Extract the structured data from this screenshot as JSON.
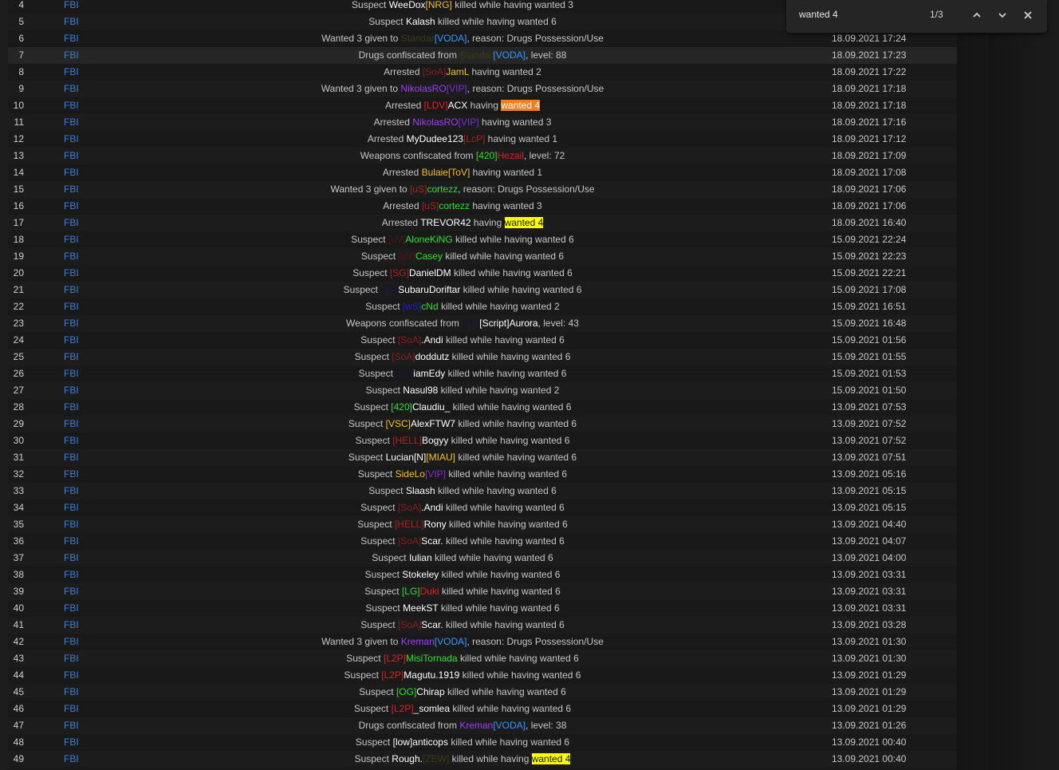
{
  "find_bar": {
    "query": "wanted 4",
    "match_count": "1/3"
  },
  "rows": [
    {
      "num": "4",
      "faction": "FBI",
      "date": "",
      "segments": [
        {
          "t": "Suspect ",
          "c": "#c6c6c6"
        },
        {
          "t": "WeeDox",
          "c": "#ffffff"
        },
        {
          "t": "[NRG]",
          "c": "#f2c21b"
        },
        {
          "t": " killed while having wanted 3",
          "c": "#c6c6c6"
        }
      ]
    },
    {
      "num": "5",
      "faction": "FBI",
      "date": "",
      "segments": [
        {
          "t": "Suspect ",
          "c": "#c6c6c6"
        },
        {
          "t": "Kalash",
          "c": "#ffffff"
        },
        {
          "t": " killed while having wanted 6",
          "c": "#c6c6c6"
        }
      ]
    },
    {
      "num": "6",
      "faction": "FBI",
      "date": "18.09.2021 17:24",
      "segments": [
        {
          "t": "Wanted 3 given to ",
          "c": "#c6c6c6"
        },
        {
          "t": "Standar",
          "c": "#3c3c14"
        },
        {
          "t": "[VODA]",
          "c": "#2d9bff"
        },
        {
          "t": ", reason: Drugs Possession/Use",
          "c": "#c6c6c6"
        }
      ]
    },
    {
      "num": "7",
      "faction": "FBI",
      "date": "18.09.2021 17:23",
      "segments": [
        {
          "t": "Drugs confiscated from ",
          "c": "#c6c6c6"
        },
        {
          "t": "Standar",
          "c": "#3c3c14"
        },
        {
          "t": "[VODA]",
          "c": "#2d9bff"
        },
        {
          "t": ", level: 88",
          "c": "#c6c6c6"
        }
      ]
    },
    {
      "num": "8",
      "faction": "FBI",
      "date": "18.09.2021 17:22",
      "segments": [
        {
          "t": "Arrested ",
          "c": "#c6c6c6"
        },
        {
          "t": "[SoA]",
          "c": "#8c1f1f"
        },
        {
          "t": "JamL",
          "c": "#f2c21b"
        },
        {
          "t": " having wanted 2",
          "c": "#c6c6c6"
        }
      ]
    },
    {
      "num": "9",
      "faction": "FBI",
      "date": "18.09.2021 17:18",
      "segments": [
        {
          "t": "Wanted 3 given to ",
          "c": "#c6c6c6"
        },
        {
          "t": "NikolasRO",
          "c": "#a23cff"
        },
        {
          "t": "[VIP]",
          "c": "#7b2fd0"
        },
        {
          "t": ", reason: Drugs Possession/Use",
          "c": "#c6c6c6"
        }
      ]
    },
    {
      "num": "10",
      "faction": "FBI",
      "date": "18.09.2021 17:18",
      "segments": [
        {
          "t": "Arrested ",
          "c": "#c6c6c6"
        },
        {
          "t": "[LDV]",
          "c": "#e02020"
        },
        {
          "t": "ACX",
          "c": "#ffffff"
        },
        {
          "t": " having ",
          "c": "#c6c6c6"
        },
        {
          "t": "wanted 4",
          "c": "#ffffff",
          "bg": "#f07f1e"
        }
      ]
    },
    {
      "num": "11",
      "faction": "FBI",
      "date": "18.09.2021 17:16",
      "segments": [
        {
          "t": "Arrested ",
          "c": "#c6c6c6"
        },
        {
          "t": "NikolasRO",
          "c": "#a23cff"
        },
        {
          "t": "[VIP]",
          "c": "#7b2fd0"
        },
        {
          "t": " having wanted 3",
          "c": "#c6c6c6"
        }
      ]
    },
    {
      "num": "12",
      "faction": "FBI",
      "date": "18.09.2021 17:12",
      "segments": [
        {
          "t": "Arrested ",
          "c": "#c6c6c6"
        },
        {
          "t": "MyDudee123",
          "c": "#ffffff"
        },
        {
          "t": "[LcP]",
          "c": "#b02020"
        },
        {
          "t": " having wanted 1",
          "c": "#c6c6c6"
        }
      ]
    },
    {
      "num": "13",
      "faction": "FBI",
      "date": "18.09.2021 17:09",
      "segments": [
        {
          "t": "Weapons confiscated from ",
          "c": "#c6c6c6"
        },
        {
          "t": "[420]",
          "c": "#2ee02e"
        },
        {
          "t": "Hezail",
          "c": "#e02020"
        },
        {
          "t": ", level: 72",
          "c": "#c6c6c6"
        }
      ]
    },
    {
      "num": "14",
      "faction": "FBI",
      "date": "18.09.2021 17:08",
      "segments": [
        {
          "t": "Arrested ",
          "c": "#c6c6c6"
        },
        {
          "t": "Bulaie",
          "c": "#f2c21b"
        },
        {
          "t": "[ToV]",
          "c": "#f2c21b"
        },
        {
          "t": " having wanted 1",
          "c": "#c6c6c6"
        }
      ]
    },
    {
      "num": "15",
      "faction": "FBI",
      "date": "18.09.2021 17:06",
      "segments": [
        {
          "t": "Wanted 3 given to ",
          "c": "#c6c6c6"
        },
        {
          "t": "[uS]",
          "c": "#b02020"
        },
        {
          "t": "cortezz",
          "c": "#2ee02e"
        },
        {
          "t": ", reason: Drugs Possession/Use",
          "c": "#c6c6c6"
        }
      ]
    },
    {
      "num": "16",
      "faction": "FBI",
      "date": "18.09.2021 17:06",
      "segments": [
        {
          "t": "Arrested ",
          "c": "#c6c6c6"
        },
        {
          "t": "[uS]",
          "c": "#b02020"
        },
        {
          "t": "cortezz",
          "c": "#2ee02e"
        },
        {
          "t": " having wanted 3",
          "c": "#c6c6c6"
        }
      ]
    },
    {
      "num": "17",
      "faction": "FBI",
      "date": "18.09.2021 16:40",
      "segments": [
        {
          "t": "Arrested ",
          "c": "#c6c6c6"
        },
        {
          "t": "TREVOR42",
          "c": "#ffffff"
        },
        {
          "t": " having ",
          "c": "#c6c6c6"
        },
        {
          "t": "wanted 4",
          "c": "#111111",
          "bg": "#ffff00"
        }
      ]
    },
    {
      "num": "18",
      "faction": "FBI",
      "date": "15.09.2021 22:24",
      "segments": [
        {
          "t": "Suspect ",
          "c": "#c6c6c6"
        },
        {
          "t": "[uV]",
          "c": "#5a1414"
        },
        {
          "t": "AloneKiNG",
          "c": "#2ee02e"
        },
        {
          "t": " killed while having wanted 6",
          "c": "#c6c6c6"
        }
      ]
    },
    {
      "num": "19",
      "faction": "FBI",
      "date": "15.09.2021 22:23",
      "segments": [
        {
          "t": "Suspect ",
          "c": "#c6c6c6"
        },
        {
          "t": "[uV]",
          "c": "#5a1414"
        },
        {
          "t": "Casey",
          "c": "#2ee02e"
        },
        {
          "t": " killed while having wanted 6",
          "c": "#c6c6c6"
        }
      ]
    },
    {
      "num": "20",
      "faction": "FBI",
      "date": "15.09.2021 22:21",
      "segments": [
        {
          "t": "Suspect ",
          "c": "#c6c6c6"
        },
        {
          "t": "[SG]",
          "c": "#b02020"
        },
        {
          "t": "DanielDM",
          "c": "#ffffff"
        },
        {
          "t": " killed while having wanted 6",
          "c": "#c6c6c6"
        }
      ]
    },
    {
      "num": "21",
      "faction": "FBI",
      "date": "15.09.2021 17:08",
      "segments": [
        {
          "t": "Suspect ",
          "c": "#c6c6c6"
        },
        {
          "t": "[FB]",
          "c": "#15153c"
        },
        {
          "t": "SubaruDoriftar",
          "c": "#ffffff"
        },
        {
          "t": " killed while having wanted 6",
          "c": "#c6c6c6"
        }
      ]
    },
    {
      "num": "22",
      "faction": "FBI",
      "date": "15.09.2021 16:51",
      "segments": [
        {
          "t": "Suspect ",
          "c": "#c6c6c6"
        },
        {
          "t": "[wS]",
          "c": "#2020e0"
        },
        {
          "t": "cNd",
          "c": "#2ee02e"
        },
        {
          "t": " killed while having wanted 2",
          "c": "#c6c6c6"
        }
      ]
    },
    {
      "num": "23",
      "faction": "FBI",
      "date": "15.09.2021 16:48",
      "segments": [
        {
          "t": "Weapons confiscated from ",
          "c": "#c6c6c6"
        },
        {
          "t": "[FB]",
          "c": "#15153c"
        },
        {
          "t": "[Script]Aurora",
          "c": "#ffffff"
        },
        {
          "t": ", level: 43",
          "c": "#c6c6c6"
        }
      ]
    },
    {
      "num": "24",
      "faction": "FBI",
      "date": "15.09.2021 01:56",
      "segments": [
        {
          "t": "Suspect ",
          "c": "#c6c6c6"
        },
        {
          "t": "[SoA]",
          "c": "#8c1f1f"
        },
        {
          "t": ".Andi",
          "c": "#ffffff"
        },
        {
          "t": " killed while having wanted 6",
          "c": "#c6c6c6"
        }
      ]
    },
    {
      "num": "25",
      "faction": "FBI",
      "date": "15.09.2021 01:55",
      "segments": [
        {
          "t": "Suspect ",
          "c": "#c6c6c6"
        },
        {
          "t": "[SoA]",
          "c": "#8c1f1f"
        },
        {
          "t": "doddutz",
          "c": "#ffffff"
        },
        {
          "t": " killed while having wanted 6",
          "c": "#c6c6c6"
        }
      ]
    },
    {
      "num": "26",
      "faction": "FBI",
      "date": "15.09.2021 01:53",
      "segments": [
        {
          "t": "Suspect ",
          "c": "#c6c6c6"
        },
        {
          "t": "[FB]",
          "c": "#15153c"
        },
        {
          "t": "iamEdy",
          "c": "#ffffff"
        },
        {
          "t": " killed while having wanted 6",
          "c": "#c6c6c6"
        }
      ]
    },
    {
      "num": "27",
      "faction": "FBI",
      "date": "15.09.2021 01:50",
      "segments": [
        {
          "t": "Suspect ",
          "c": "#c6c6c6"
        },
        {
          "t": "Nasul98",
          "c": "#ffffff"
        },
        {
          "t": " killed while having wanted 2",
          "c": "#c6c6c6"
        }
      ]
    },
    {
      "num": "28",
      "faction": "FBI",
      "date": "13.09.2021 07:53",
      "segments": [
        {
          "t": "Suspect ",
          "c": "#c6c6c6"
        },
        {
          "t": "[420]",
          "c": "#2ee02e"
        },
        {
          "t": "Claudiu_",
          "c": "#ffffff"
        },
        {
          "t": " killed while having wanted 6",
          "c": "#c6c6c6"
        }
      ]
    },
    {
      "num": "29",
      "faction": "FBI",
      "date": "13.09.2021 07:52",
      "segments": [
        {
          "t": "Suspect ",
          "c": "#c6c6c6"
        },
        {
          "t": "[VSC]",
          "c": "#f2c21b"
        },
        {
          "t": "AlexFTW7",
          "c": "#ffffff"
        },
        {
          "t": " killed while having wanted 6",
          "c": "#c6c6c6"
        }
      ]
    },
    {
      "num": "30",
      "faction": "FBI",
      "date": "13.09.2021 07:52",
      "segments": [
        {
          "t": "Suspect ",
          "c": "#c6c6c6"
        },
        {
          "t": "[HELL]",
          "c": "#b02020"
        },
        {
          "t": "Bogyy",
          "c": "#ffffff"
        },
        {
          "t": " killed while having wanted 6",
          "c": "#c6c6c6"
        }
      ]
    },
    {
      "num": "31",
      "faction": "FBI",
      "date": "13.09.2021 07:51",
      "segments": [
        {
          "t": "Suspect ",
          "c": "#c6c6c6"
        },
        {
          "t": "Lucian[N]",
          "c": "#ffffff"
        },
        {
          "t": "[MIAU]",
          "c": "#f2c21b"
        },
        {
          "t": " killed while having wanted 6",
          "c": "#c6c6c6"
        }
      ]
    },
    {
      "num": "32",
      "faction": "FBI",
      "date": "13.09.2021 05:16",
      "segments": [
        {
          "t": "Suspect ",
          "c": "#c6c6c6"
        },
        {
          "t": "SideLo",
          "c": "#f2c21b"
        },
        {
          "t": "[VIP]",
          "c": "#7b2fd0"
        },
        {
          "t": " killed while having wanted 6",
          "c": "#c6c6c6"
        }
      ]
    },
    {
      "num": "33",
      "faction": "FBI",
      "date": "13.09.2021 05:15",
      "segments": [
        {
          "t": "Suspect ",
          "c": "#c6c6c6"
        },
        {
          "t": "Slaash",
          "c": "#ffffff"
        },
        {
          "t": " killed while having wanted 6",
          "c": "#c6c6c6"
        }
      ]
    },
    {
      "num": "34",
      "faction": "FBI",
      "date": "13.09.2021 05:15",
      "segments": [
        {
          "t": "Suspect ",
          "c": "#c6c6c6"
        },
        {
          "t": "[SoA]",
          "c": "#8c1f1f"
        },
        {
          "t": ".Andi",
          "c": "#ffffff"
        },
        {
          "t": " killed while having wanted 6",
          "c": "#c6c6c6"
        }
      ]
    },
    {
      "num": "35",
      "faction": "FBI",
      "date": "13.09.2021 04:40",
      "segments": [
        {
          "t": "Suspect ",
          "c": "#c6c6c6"
        },
        {
          "t": "[HELL]",
          "c": "#b02020"
        },
        {
          "t": "Rony",
          "c": "#ffffff"
        },
        {
          "t": " killed while having wanted 6",
          "c": "#c6c6c6"
        }
      ]
    },
    {
      "num": "36",
      "faction": "FBI",
      "date": "13.09.2021 04:07",
      "segments": [
        {
          "t": "Suspect ",
          "c": "#c6c6c6"
        },
        {
          "t": "[SoA]",
          "c": "#8c1f1f"
        },
        {
          "t": "Scar.",
          "c": "#ffffff"
        },
        {
          "t": " killed while having wanted 6",
          "c": "#c6c6c6"
        }
      ]
    },
    {
      "num": "37",
      "faction": "FBI",
      "date": "13.09.2021 04:00",
      "segments": [
        {
          "t": "Suspect ",
          "c": "#c6c6c6"
        },
        {
          "t": "Iulian",
          "c": "#ffffff"
        },
        {
          "t": " killed while having wanted 6",
          "c": "#c6c6c6"
        }
      ]
    },
    {
      "num": "38",
      "faction": "FBI",
      "date": "13.09.2021 03:31",
      "segments": [
        {
          "t": "Suspect ",
          "c": "#c6c6c6"
        },
        {
          "t": "Stokeley",
          "c": "#ffffff"
        },
        {
          "t": " killed while having wanted 6",
          "c": "#c6c6c6"
        }
      ]
    },
    {
      "num": "39",
      "faction": "FBI",
      "date": "13.09.2021 03:31",
      "segments": [
        {
          "t": "Suspect ",
          "c": "#c6c6c6"
        },
        {
          "t": "[LG]",
          "c": "#2ee02e"
        },
        {
          "t": "Duki",
          "c": "#e02020"
        },
        {
          "t": " killed while having wanted 6",
          "c": "#c6c6c6"
        }
      ]
    },
    {
      "num": "40",
      "faction": "FBI",
      "date": "13.09.2021 03:31",
      "segments": [
        {
          "t": "Suspect ",
          "c": "#c6c6c6"
        },
        {
          "t": "MeekST",
          "c": "#ffffff"
        },
        {
          "t": " killed while having wanted 6",
          "c": "#c6c6c6"
        }
      ]
    },
    {
      "num": "41",
      "faction": "FBI",
      "date": "13.09.2021 03:28",
      "segments": [
        {
          "t": "Suspect ",
          "c": "#c6c6c6"
        },
        {
          "t": "[SoA]",
          "c": "#8c1f1f"
        },
        {
          "t": "Scar.",
          "c": "#ffffff"
        },
        {
          "t": " killed while having wanted 6",
          "c": "#c6c6c6"
        }
      ]
    },
    {
      "num": "42",
      "faction": "FBI",
      "date": "13.09.2021 01:30",
      "segments": [
        {
          "t": "Wanted 3 given to ",
          "c": "#c6c6c6"
        },
        {
          "t": "Kreman",
          "c": "#a23cff"
        },
        {
          "t": "[VODA]",
          "c": "#2d9bff"
        },
        {
          "t": ", reason: Drugs Possession/Use",
          "c": "#c6c6c6"
        }
      ]
    },
    {
      "num": "43",
      "faction": "FBI",
      "date": "13.09.2021 01:30",
      "segments": [
        {
          "t": "Suspect ",
          "c": "#c6c6c6"
        },
        {
          "t": "[L2P]",
          "c": "#e02020"
        },
        {
          "t": "MisiTornada",
          "c": "#2ee02e"
        },
        {
          "t": " killed while having wanted 6",
          "c": "#c6c6c6"
        }
      ]
    },
    {
      "num": "44",
      "faction": "FBI",
      "date": "13.09.2021 01:29",
      "segments": [
        {
          "t": "Suspect ",
          "c": "#c6c6c6"
        },
        {
          "t": "[L2P]",
          "c": "#e02020"
        },
        {
          "t": "Magutu.1919",
          "c": "#ffffff"
        },
        {
          "t": " killed while having wanted 6",
          "c": "#c6c6c6"
        }
      ]
    },
    {
      "num": "45",
      "faction": "FBI",
      "date": "13.09.2021 01:29",
      "segments": [
        {
          "t": "Suspect ",
          "c": "#c6c6c6"
        },
        {
          "t": "[OG]",
          "c": "#2ee02e"
        },
        {
          "t": "Chirap",
          "c": "#ffffff"
        },
        {
          "t": " killed while having wanted 6",
          "c": "#c6c6c6"
        }
      ]
    },
    {
      "num": "46",
      "faction": "FBI",
      "date": "13.09.2021 01:29",
      "segments": [
        {
          "t": "Suspect ",
          "c": "#c6c6c6"
        },
        {
          "t": "[L2P]",
          "c": "#e02020"
        },
        {
          "t": "_somlea",
          "c": "#ffffff"
        },
        {
          "t": " killed while having wanted 6",
          "c": "#c6c6c6"
        }
      ]
    },
    {
      "num": "47",
      "faction": "FBI",
      "date": "13.09.2021 01:26",
      "segments": [
        {
          "t": "Drugs confiscated from ",
          "c": "#c6c6c6"
        },
        {
          "t": "Kreman",
          "c": "#a23cff"
        },
        {
          "t": "[VODA]",
          "c": "#2d9bff"
        },
        {
          "t": ", level: 38",
          "c": "#c6c6c6"
        }
      ]
    },
    {
      "num": "48",
      "faction": "FBI",
      "date": "13.09.2021 00:40",
      "segments": [
        {
          "t": "Suspect ",
          "c": "#c6c6c6"
        },
        {
          "t": "[low]anticops",
          "c": "#ffffff"
        },
        {
          "t": " killed while having wanted 6",
          "c": "#c6c6c6"
        }
      ]
    },
    {
      "num": "49",
      "faction": "FBI",
      "date": "13.09.2021 00:40",
      "segments": [
        {
          "t": "Suspect ",
          "c": "#c6c6c6"
        },
        {
          "t": "Rough.",
          "c": "#ffffff"
        },
        {
          "t": "[ZEW]",
          "c": "#3c3c14"
        },
        {
          "t": " killed while having ",
          "c": "#c6c6c6"
        },
        {
          "t": "wanted 4",
          "c": "#111111",
          "bg": "#ffff00"
        }
      ]
    }
  ]
}
